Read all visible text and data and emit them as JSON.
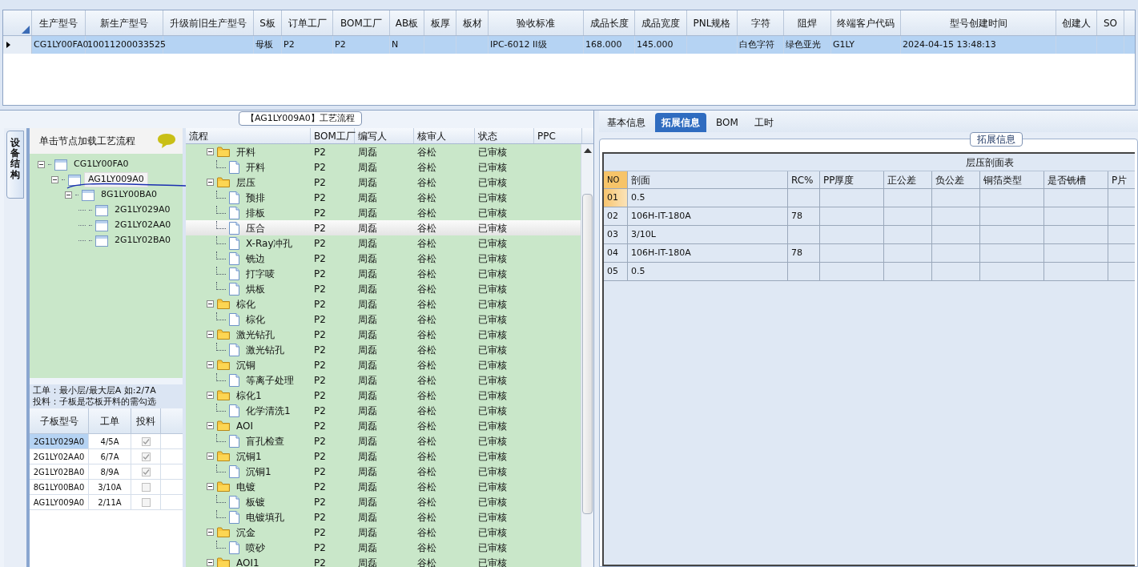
{
  "main_table": {
    "columns": [
      "生产型号",
      "新生产型号",
      "升级前旧生产型号",
      "S板",
      "订单工厂",
      "BOM工厂",
      "AB板",
      "板厚",
      "板材",
      "验收标准",
      "成品长度",
      "成品宽度",
      "PNL规格",
      "字符",
      "阻焊",
      "终端客户代码",
      "型号创建时间",
      "创建人",
      "SO"
    ],
    "rows": [
      {
        "selected": true,
        "cells": [
          "CG1LY00FA0",
          "10011200033525",
          "",
          "母板",
          "P2",
          "P2",
          "N",
          "",
          "",
          "IPC-6012 II级",
          "168.000",
          "145.000",
          "",
          "白色字符",
          "绿色亚光",
          "G1LY",
          "2024-04-15 13:48:13",
          "",
          ""
        ]
      }
    ]
  },
  "left_panel": {
    "side_tab": "设备结构",
    "hint": "单击节点加载工艺流程",
    "tree": [
      {
        "label": "CG1LY00FA0",
        "expanded": true,
        "selected": false,
        "children": [
          {
            "label": "AG1LY009A0",
            "expanded": true,
            "selected": true,
            "children": [
              {
                "label": "8G1LY00BA0",
                "expanded": true,
                "selected": false,
                "children": [
                  {
                    "label": "2G1LY029A0",
                    "selected": false
                  },
                  {
                    "label": "2G1LY02AA0",
                    "selected": false
                  },
                  {
                    "label": "2G1LY02BA0",
                    "selected": false
                  }
                ]
              }
            ]
          }
        ]
      }
    ],
    "notes": [
      "工单：最小层/最大层A 如:2/7A",
      "投料：子板是芯板开料的需勾选"
    ],
    "sub_table": {
      "columns": [
        "子板型号",
        "工单",
        "投料"
      ],
      "rows": [
        {
          "cells": [
            "2G1LY029A0",
            "4/5A"
          ],
          "checked": true,
          "selected": true
        },
        {
          "cells": [
            "2G1LY02AA0",
            "6/7A"
          ],
          "checked": true,
          "selected": false
        },
        {
          "cells": [
            "2G1LY02BA0",
            "8/9A"
          ],
          "checked": true,
          "selected": false
        },
        {
          "cells": [
            "8G1LY00BA0",
            "3/10A"
          ],
          "checked": false,
          "selected": false
        },
        {
          "cells": [
            "AG1LY009A0",
            "2/11A"
          ],
          "checked": false,
          "selected": false
        }
      ]
    }
  },
  "process_panel": {
    "title": "【AG1LY009A0】工艺流程",
    "columns": [
      "流程",
      "BOM工厂",
      "编写人",
      "核审人",
      "状态",
      "PPC"
    ],
    "groups": [
      {
        "expanded": true,
        "cells": [
          "开料",
          "P2",
          "周磊",
          "谷松",
          "已审核"
        ],
        "children": [
          {
            "selected": false,
            "cells": [
              "开料",
              "P2",
              "周磊",
              "谷松",
              "已审核"
            ]
          }
        ]
      },
      {
        "expanded": true,
        "cells": [
          "层压",
          "P2",
          "周磊",
          "谷松",
          "已审核"
        ],
        "children": [
          {
            "selected": false,
            "cells": [
              "预排",
              "P2",
              "周磊",
              "谷松",
              "已审核"
            ]
          },
          {
            "selected": false,
            "cells": [
              "排板",
              "P2",
              "周磊",
              "谷松",
              "已审核"
            ]
          },
          {
            "selected": true,
            "cells": [
              "压合",
              "P2",
              "周磊",
              "谷松",
              "已审核"
            ]
          },
          {
            "selected": false,
            "cells": [
              "X-Ray冲孔",
              "P2",
              "周磊",
              "谷松",
              "已审核"
            ]
          },
          {
            "selected": false,
            "cells": [
              "铣边",
              "P2",
              "周磊",
              "谷松",
              "已审核"
            ]
          },
          {
            "selected": false,
            "cells": [
              "打字唛",
              "P2",
              "周磊",
              "谷松",
              "已审核"
            ]
          },
          {
            "selected": false,
            "cells": [
              "烘板",
              "P2",
              "周磊",
              "谷松",
              "已审核"
            ]
          }
        ]
      },
      {
        "expanded": true,
        "cells": [
          "棕化",
          "P2",
          "周磊",
          "谷松",
          "已审核"
        ],
        "children": [
          {
            "selected": false,
            "cells": [
              "棕化",
              "P2",
              "周磊",
              "谷松",
              "已审核"
            ]
          }
        ]
      },
      {
        "expanded": true,
        "cells": [
          "激光钻孔",
          "P2",
          "周磊",
          "谷松",
          "已审核"
        ],
        "children": [
          {
            "selected": false,
            "cells": [
              "激光钻孔",
              "P2",
              "周磊",
              "谷松",
              "已审核"
            ]
          }
        ]
      },
      {
        "expanded": true,
        "cells": [
          "沉铜",
          "P2",
          "周磊",
          "谷松",
          "已审核"
        ],
        "children": [
          {
            "selected": false,
            "cells": [
              "等离子处理",
              "P2",
              "周磊",
              "谷松",
              "已审核"
            ]
          }
        ]
      },
      {
        "expanded": true,
        "cells": [
          "棕化1",
          "P2",
          "周磊",
          "谷松",
          "已审核"
        ],
        "children": [
          {
            "selected": false,
            "cells": [
              "化学清洗1",
              "P2",
              "周磊",
              "谷松",
              "已审核"
            ]
          }
        ]
      },
      {
        "expanded": true,
        "cells": [
          "AOI",
          "P2",
          "周磊",
          "谷松",
          "已审核"
        ],
        "children": [
          {
            "selected": false,
            "cells": [
              "盲孔检查",
              "P2",
              "周磊",
              "谷松",
              "已审核"
            ]
          }
        ]
      },
      {
        "expanded": true,
        "cells": [
          "沉铜1",
          "P2",
          "周磊",
          "谷松",
          "已审核"
        ],
        "children": [
          {
            "selected": false,
            "cells": [
              "沉铜1",
              "P2",
              "周磊",
              "谷松",
              "已审核"
            ]
          }
        ]
      },
      {
        "expanded": true,
        "cells": [
          "电镀",
          "P2",
          "周磊",
          "谷松",
          "已审核"
        ],
        "children": [
          {
            "selected": false,
            "cells": [
              "板镀",
              "P2",
              "周磊",
              "谷松",
              "已审核"
            ]
          },
          {
            "selected": false,
            "cells": [
              "电镀填孔",
              "P2",
              "周磊",
              "谷松",
              "已审核"
            ]
          }
        ]
      },
      {
        "expanded": true,
        "cells": [
          "沉金",
          "P2",
          "周磊",
          "谷松",
          "已审核"
        ],
        "children": [
          {
            "selected": false,
            "cells": [
              "喷砂",
              "P2",
              "周磊",
              "谷松",
              "已审核"
            ]
          }
        ]
      },
      {
        "expanded": true,
        "cells": [
          "AOI1",
          "P2",
          "周磊",
          "谷松",
          "已审核"
        ]
      }
    ]
  },
  "right_panel": {
    "tabs": [
      {
        "label": "基本信息",
        "selected": false
      },
      {
        "label": "拓展信息",
        "selected": true
      },
      {
        "label": "BOM",
        "selected": false
      },
      {
        "label": "工时",
        "selected": false
      }
    ],
    "group_title": "拓展信息",
    "table_title": "层压剖面表",
    "columns": [
      "NO",
      "剖面",
      "RC%",
      "PP厚度",
      "正公差",
      "负公差",
      "铜箔类型",
      "是否铣槽",
      "P片"
    ],
    "rows": [
      {
        "selected": true,
        "cells": [
          "01",
          "0.5",
          "",
          "",
          "",
          "",
          "",
          "",
          ""
        ]
      },
      {
        "selected": false,
        "cells": [
          "02",
          "106H-IT-180A",
          "78",
          "",
          "",
          "",
          "",
          "",
          ""
        ]
      },
      {
        "selected": false,
        "cells": [
          "03",
          "3/10L",
          "",
          "",
          "",
          "",
          "",
          "",
          ""
        ]
      },
      {
        "selected": false,
        "cells": [
          "04",
          "106H-IT-180A",
          "78",
          "",
          "",
          "",
          "",
          "",
          ""
        ]
      },
      {
        "selected": false,
        "cells": [
          "05",
          "0.5",
          "",
          "",
          "",
          "",
          "",
          "",
          ""
        ]
      }
    ]
  }
}
